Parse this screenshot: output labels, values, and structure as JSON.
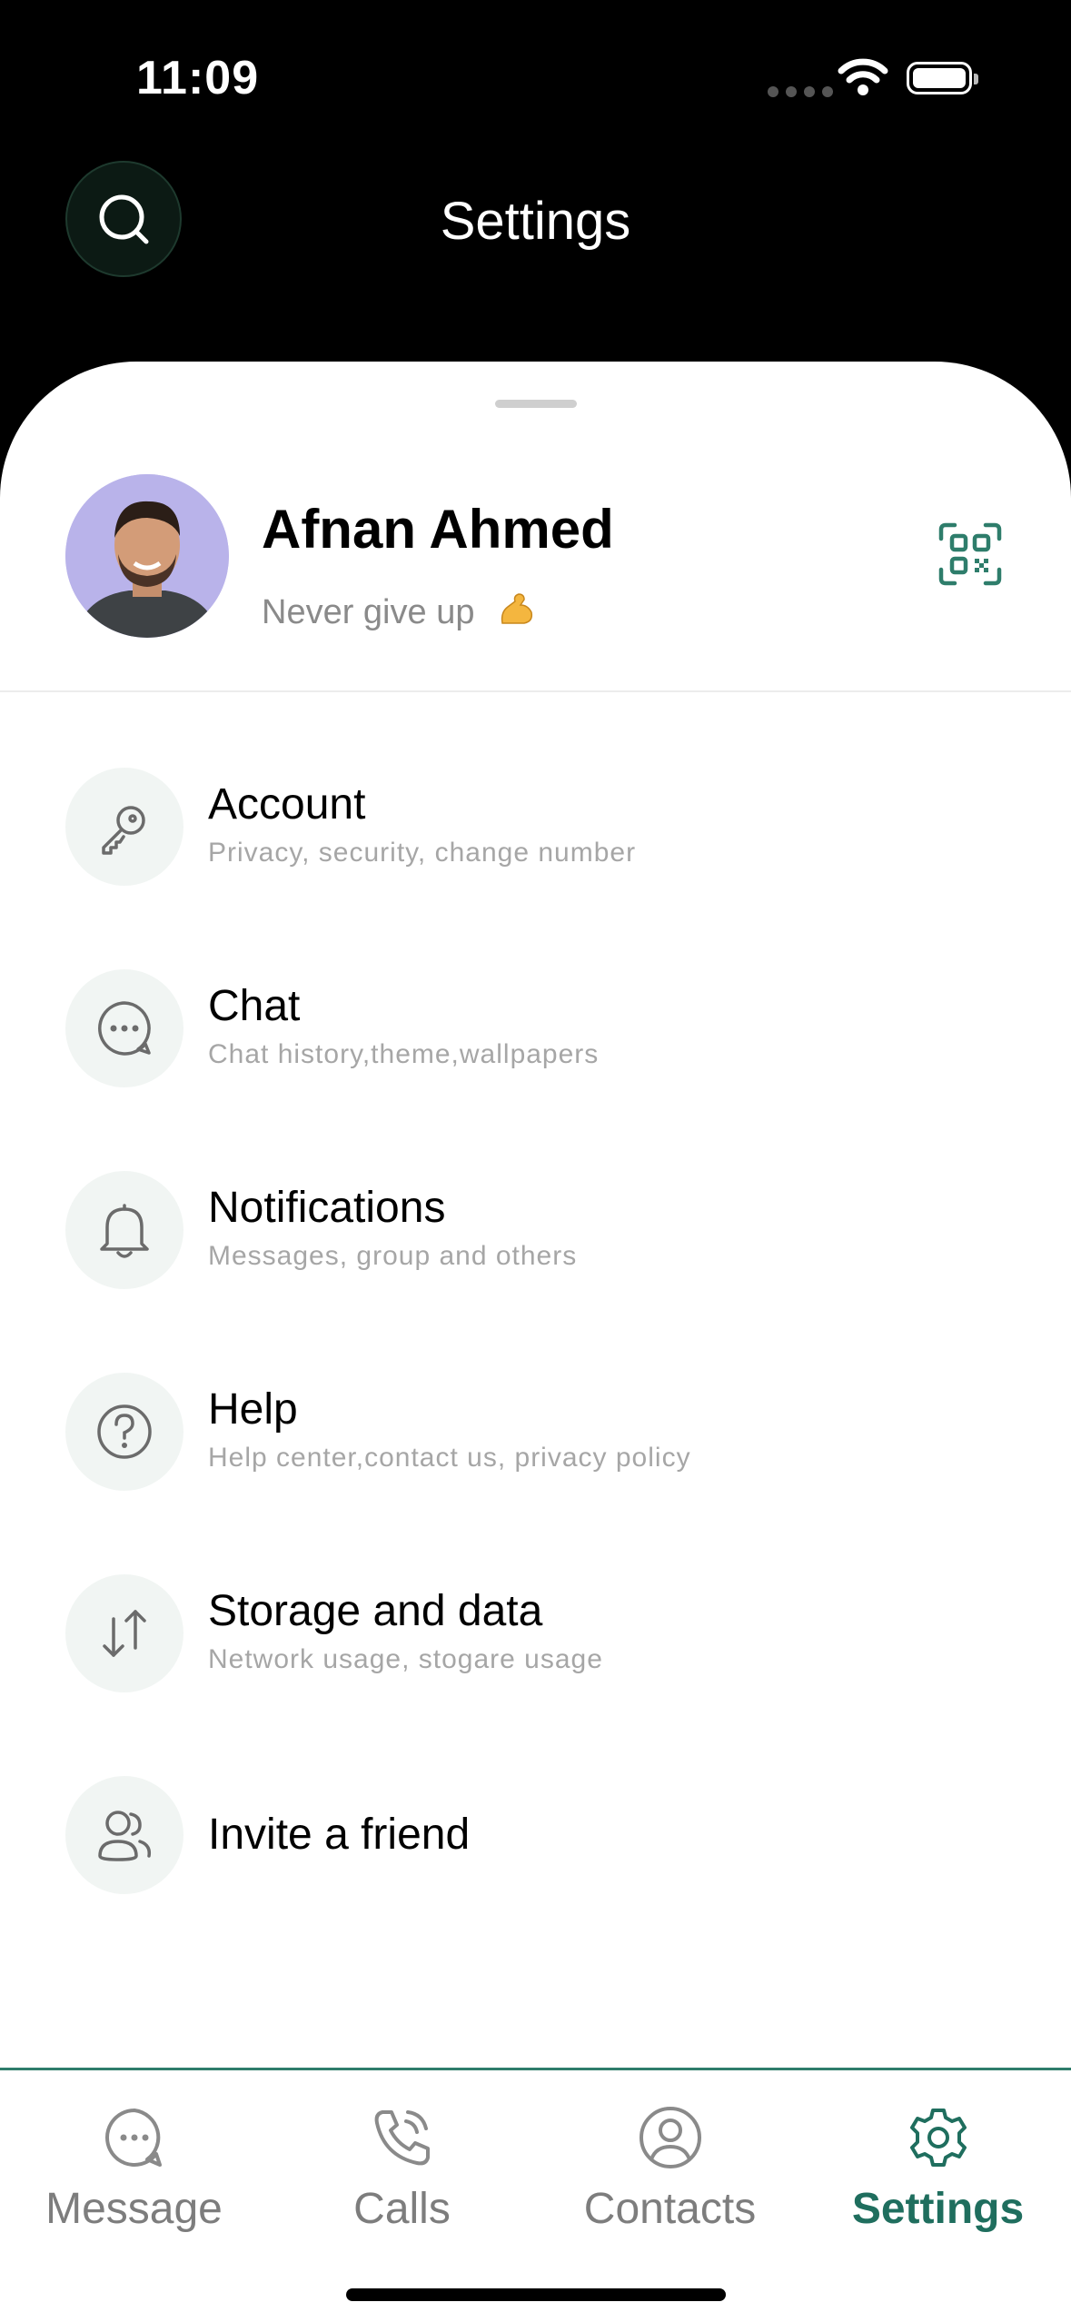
{
  "status_bar": {
    "time": "11:09"
  },
  "header": {
    "title": "Settings",
    "search_icon": "search-icon"
  },
  "profile": {
    "name": "Afnan Ahmed",
    "status": "Never give up",
    "status_emoji": "flexed-biceps",
    "qr_icon": "qr-code-icon"
  },
  "menu": {
    "items": [
      {
        "icon": "key-icon",
        "title": "Account",
        "subtitle": "Privacy, security, change number"
      },
      {
        "icon": "chat-bubble-icon",
        "title": "Chat",
        "subtitle": "Chat history,theme,wallpapers"
      },
      {
        "icon": "bell-icon",
        "title": "Notifications",
        "subtitle": "Messages, group and others"
      },
      {
        "icon": "help-icon",
        "title": "Help",
        "subtitle": "Help center,contact us, privacy policy"
      },
      {
        "icon": "transfer-arrows-icon",
        "title": "Storage and data",
        "subtitle": "Network usage, stogare usage"
      },
      {
        "icon": "users-icon",
        "title": "Invite a friend"
      }
    ]
  },
  "tabbar": {
    "tabs": [
      {
        "icon": "message-icon",
        "label": "Message",
        "active": false
      },
      {
        "icon": "phone-icon",
        "label": "Calls",
        "active": false
      },
      {
        "icon": "contact-icon",
        "label": "Contacts",
        "active": false
      },
      {
        "icon": "gear-icon",
        "label": "Settings",
        "active": true
      }
    ]
  },
  "colors": {
    "accent": "#1f6e5e",
    "header_bg": "#000000",
    "icon_bg": "#f1f5f3",
    "subtitle": "#a6a6a6"
  }
}
